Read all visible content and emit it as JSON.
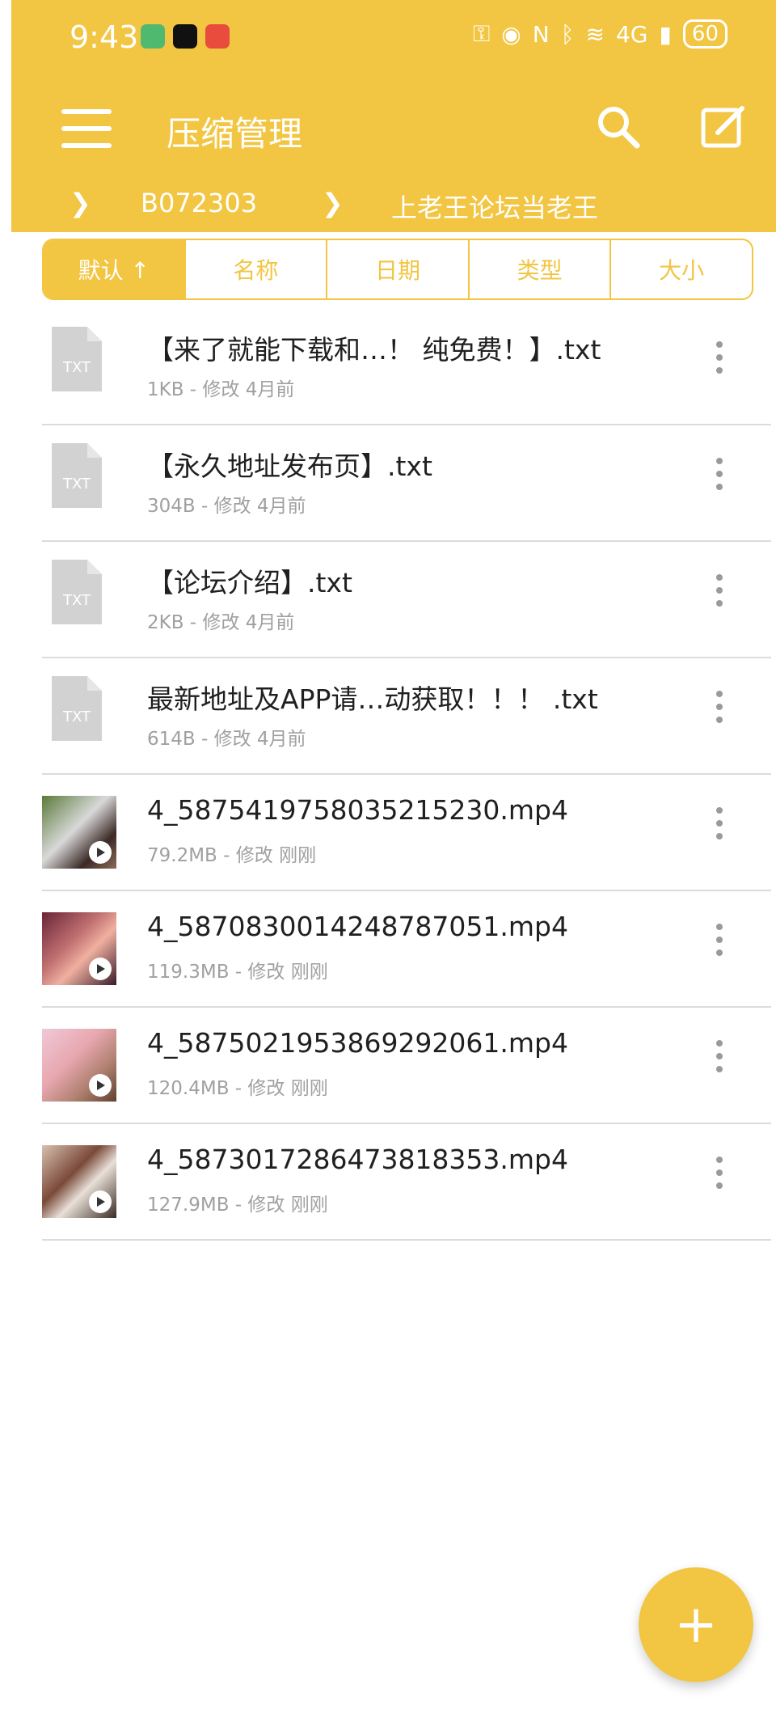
{
  "status_bar": {
    "time": "9:43",
    "battery": "60",
    "network": "4G"
  },
  "toolbar": {
    "title": "压缩管理",
    "menu_icon": "hamburger-menu-icon",
    "search_icon": "search-icon",
    "edit_icon": "edit-icon"
  },
  "breadcrumb": {
    "items": [
      "B072303",
      "上老王论坛当老王"
    ]
  },
  "sort_tabs": [
    "默认 ↑",
    "名称",
    "日期",
    "类型",
    "大小"
  ],
  "files": [
    {
      "name": "【来了就能下载和…！ 纯免费！】.txt",
      "meta": "1KB - 修改 4月前",
      "type": "txt",
      "thumb_label": "TXT"
    },
    {
      "name": "【永久地址发布页】.txt",
      "meta": "304B - 修改 4月前",
      "type": "txt",
      "thumb_label": "TXT"
    },
    {
      "name": "【论坛介绍】.txt",
      "meta": "2KB - 修改 4月前",
      "type": "txt",
      "thumb_label": "TXT"
    },
    {
      "name": "最新地址及APP请…动获取！！！ .txt",
      "meta": "614B - 修改 4月前",
      "type": "txt",
      "thumb_label": "TXT"
    },
    {
      "name": "4_5875419758035215230.mp4",
      "meta": "79.2MB - 修改 刚刚",
      "type": "mp4"
    },
    {
      "name": "4_5870830014248787051.mp4",
      "meta": "119.3MB - 修改 刚刚",
      "type": "mp4"
    },
    {
      "name": "4_5875021953869292061.mp4",
      "meta": "120.4MB - 修改 刚刚",
      "type": "mp4"
    },
    {
      "name": "4_5873017286473818353.mp4",
      "meta": "127.9MB - 修改 刚刚",
      "type": "mp4"
    }
  ],
  "fab": {
    "label": "+",
    "icon": "plus-icon"
  },
  "colors": {
    "accent": "#f2c542",
    "divider": "#dcdcdc",
    "meta_text": "#a0a0a0"
  }
}
